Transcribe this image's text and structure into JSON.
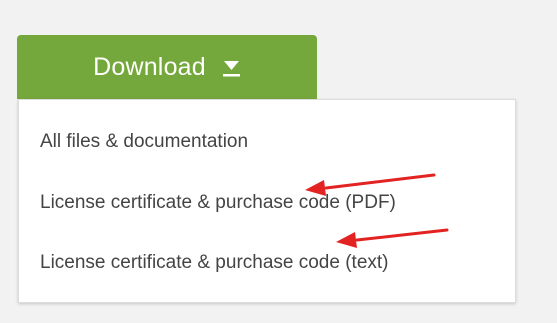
{
  "download_button": {
    "label": "Download",
    "color": "#75a83c",
    "icon": "caret-down-underline-icon"
  },
  "dropdown": {
    "items": [
      {
        "label": "All files & documentation"
      },
      {
        "label": "License certificate & purchase code (PDF)"
      },
      {
        "label": "License certificate & purchase code (text)"
      }
    ]
  },
  "annotations": {
    "arrow_color": "#e32222",
    "icon": "red-arrow-annotation"
  }
}
